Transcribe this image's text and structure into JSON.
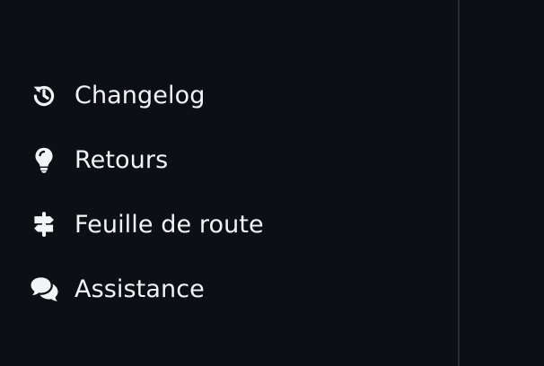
{
  "sidebar": {
    "items": [
      {
        "label": "Changelog",
        "icon": "history-icon"
      },
      {
        "label": "Retours",
        "icon": "lightbulb-icon"
      },
      {
        "label": "Feuille de route",
        "icon": "signpost-icon"
      },
      {
        "label": "Assistance",
        "icon": "chat-bubbles-icon"
      }
    ]
  },
  "colors": {
    "background": "#0e0f14",
    "text": "#f3f4f8",
    "divider": "#2a2c33"
  }
}
